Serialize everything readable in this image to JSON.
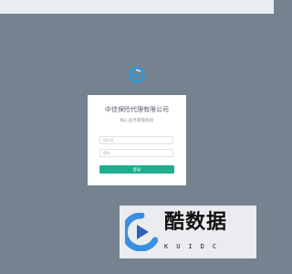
{
  "colors": {
    "background": "#758391",
    "topbar": "#e9edf1",
    "card": "#ffffff",
    "accent": "#1fae8f",
    "logo": "#1f9ee8"
  },
  "login": {
    "company_name": "中佳保险代理有限公司",
    "system_name": "核心业务管理系统",
    "username_placeholder": "用户名",
    "password_placeholder": "密码",
    "submit_label": "登录",
    "logo_icon": "brand-e-logo-icon"
  },
  "watermark": {
    "text": "酷数据",
    "sub": "KUIDC",
    "icon": "play-logo-icon"
  }
}
